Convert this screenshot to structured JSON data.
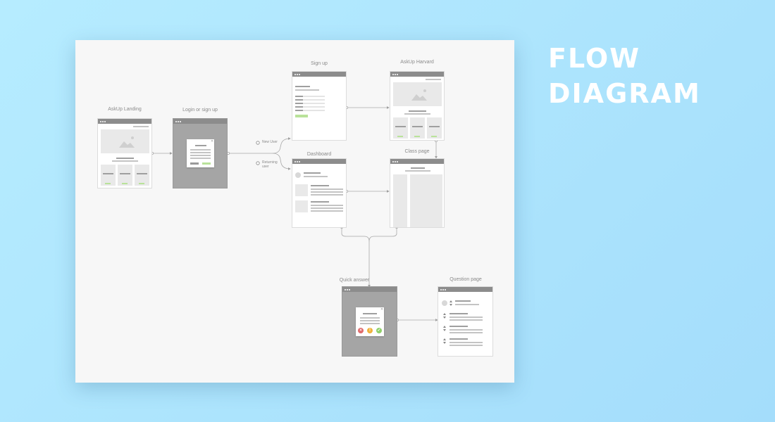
{
  "heading": {
    "line1": "FLOW",
    "line2": "DIAGRAM"
  },
  "nodes": {
    "landing": "AskUp Landing",
    "login": "Login or sign up",
    "signup": "Sign up",
    "harvard": "AskUp Harvard",
    "dashboard": "Dashboard",
    "class_page": "Class page",
    "quick_answer": "Quick answer",
    "question_page": "Question page"
  },
  "branches": {
    "new_user": "New User",
    "returning_user": "Returning user"
  },
  "colors": {
    "background": "#a9e1fc",
    "canvas": "#f7f7f7",
    "heading": "#ffffff",
    "window_bar": "#8c8c8c",
    "accent_green": "#b9e29a",
    "answer_no": "#e06a6a",
    "answer_maybe": "#f0b23a",
    "answer_yes": "#8fd06a"
  },
  "icons": {
    "close": "close-icon",
    "placeholder": "image-placeholder-icon",
    "avatar": "avatar-icon",
    "vote": "vote-arrows-icon"
  }
}
